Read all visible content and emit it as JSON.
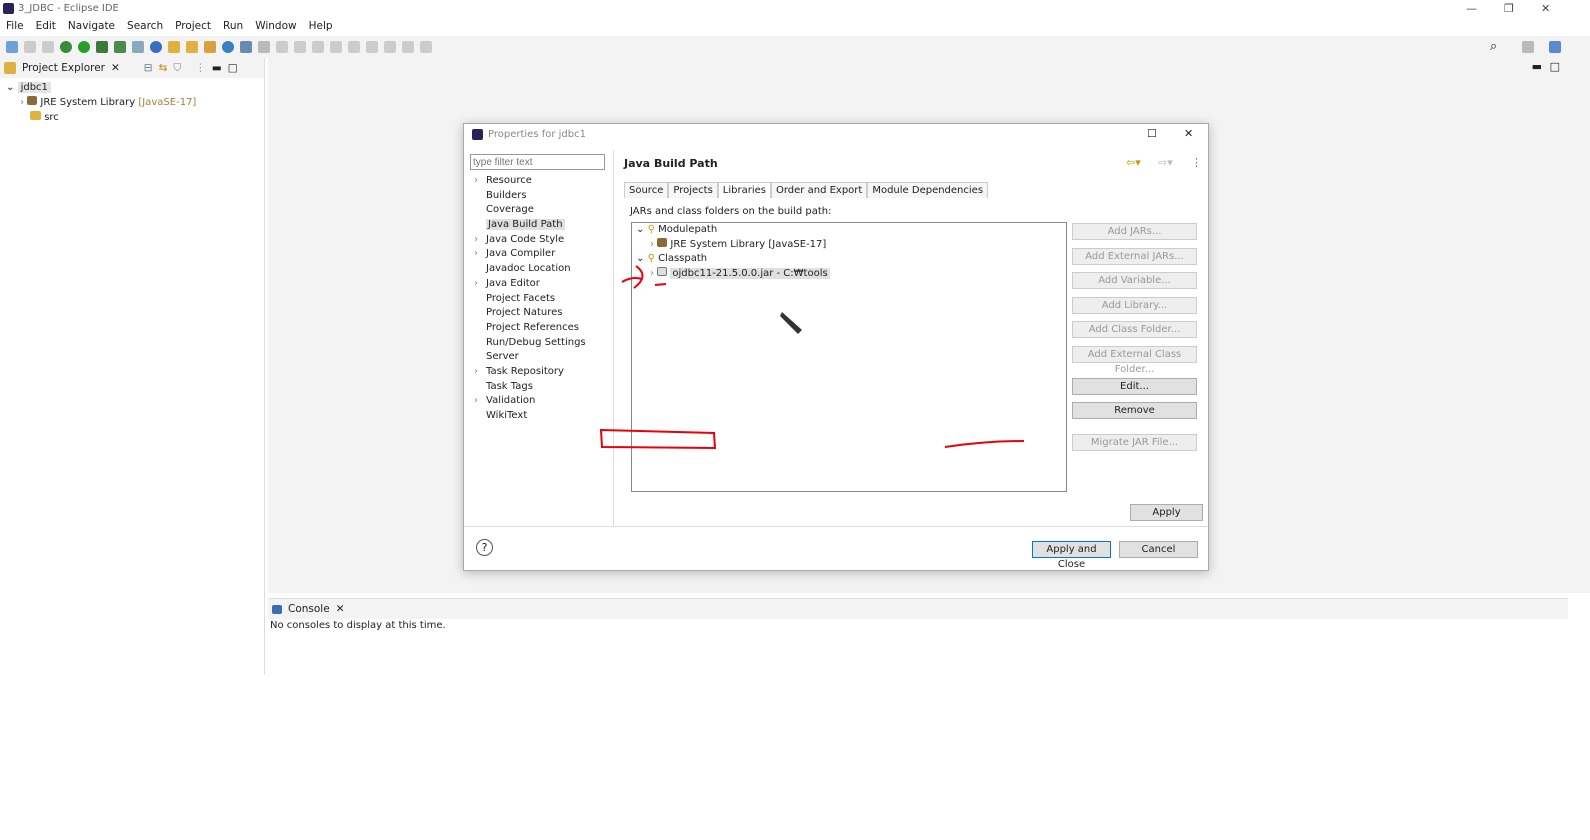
{
  "window": {
    "title": "3_JDBC - Eclipse IDE",
    "min": "—",
    "restore": "❐",
    "close": "✕"
  },
  "menu": [
    "File",
    "Edit",
    "Navigate",
    "Search",
    "Project",
    "Run",
    "Window",
    "Help"
  ],
  "explorer": {
    "title": "Project Explorer",
    "project": "jdbc1",
    "jre": "JRE System Library",
    "jre_version": "[JavaSE-17]",
    "src": "src"
  },
  "console": {
    "title": "Console",
    "message": "No consoles to display at this time."
  },
  "dialog": {
    "title": "Properties for jdbc1",
    "filter_placeholder": "type filter text",
    "nav": [
      {
        "label": "Resource",
        "exp": true
      },
      {
        "label": "Builders"
      },
      {
        "label": "Coverage"
      },
      {
        "label": "Java Build Path",
        "sel": true
      },
      {
        "label": "Java Code Style",
        "exp": true
      },
      {
        "label": "Java Compiler",
        "exp": true
      },
      {
        "label": "Javadoc Location"
      },
      {
        "label": "Java Editor",
        "exp": true
      },
      {
        "label": "Project Facets"
      },
      {
        "label": "Project Natures"
      },
      {
        "label": "Project References"
      },
      {
        "label": "Run/Debug Settings"
      },
      {
        "label": "Server"
      },
      {
        "label": "Task Repository",
        "exp": true
      },
      {
        "label": "Task Tags"
      },
      {
        "label": "Validation",
        "exp": true
      },
      {
        "label": "WikiText"
      }
    ],
    "page_title": "Java Build Path",
    "tabs": [
      "Source",
      "Projects",
      "Libraries",
      "Order and Export",
      "Module Dependencies"
    ],
    "lib_label": "JARs and class folders on the build path:",
    "tree": {
      "modulepath": "Modulepath",
      "jre": "JRE System Library [JavaSE-17]",
      "classpath": "Classpath",
      "jar": "ojdbc11-21.5.0.0.jar - C:₩tools"
    },
    "buttons": [
      "Add JARs...",
      "Add External JARs...",
      "Add Variable...",
      "Add Library...",
      "Add Class Folder...",
      "Add External Class Folder...",
      "Edit...",
      "Remove",
      "Migrate JAR File..."
    ],
    "apply": "Apply",
    "apply_close": "Apply and Close",
    "cancel": "Cancel",
    "help": "?"
  },
  "colors": {
    "accent": "#0078d7",
    "annotation": "#e8000b"
  }
}
